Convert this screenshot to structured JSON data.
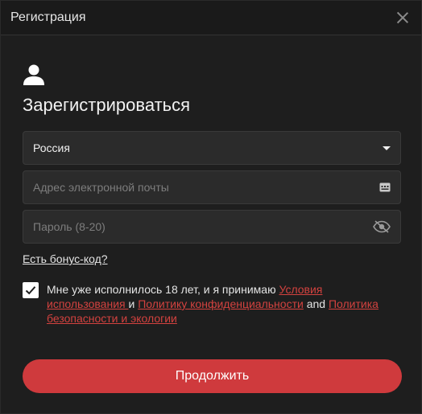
{
  "header": {
    "title": "Регистрация"
  },
  "main": {
    "title": "Зарегистрироваться"
  },
  "form": {
    "country_value": "Россия",
    "email_placeholder": "Адрес электронной почты",
    "password_placeholder": "Пароль (8-20)",
    "bonus_link": "Есть бонус-код?"
  },
  "terms": {
    "checked": true,
    "text_1": "Мне уже исполнилось 18 лет, и я принимаю ",
    "link_1": "Условия использования ",
    "text_2": " и ",
    "link_2": "Политику конфиденциальности",
    "text_3": " and ",
    "link_3": "Политика безопасности и экологии"
  },
  "actions": {
    "continue_label": "Продолжить"
  },
  "colors": {
    "background": "#1e1e1e",
    "field_background": "#2b2b2b",
    "accent": "#cf3a3d",
    "link": "#d3423f"
  }
}
